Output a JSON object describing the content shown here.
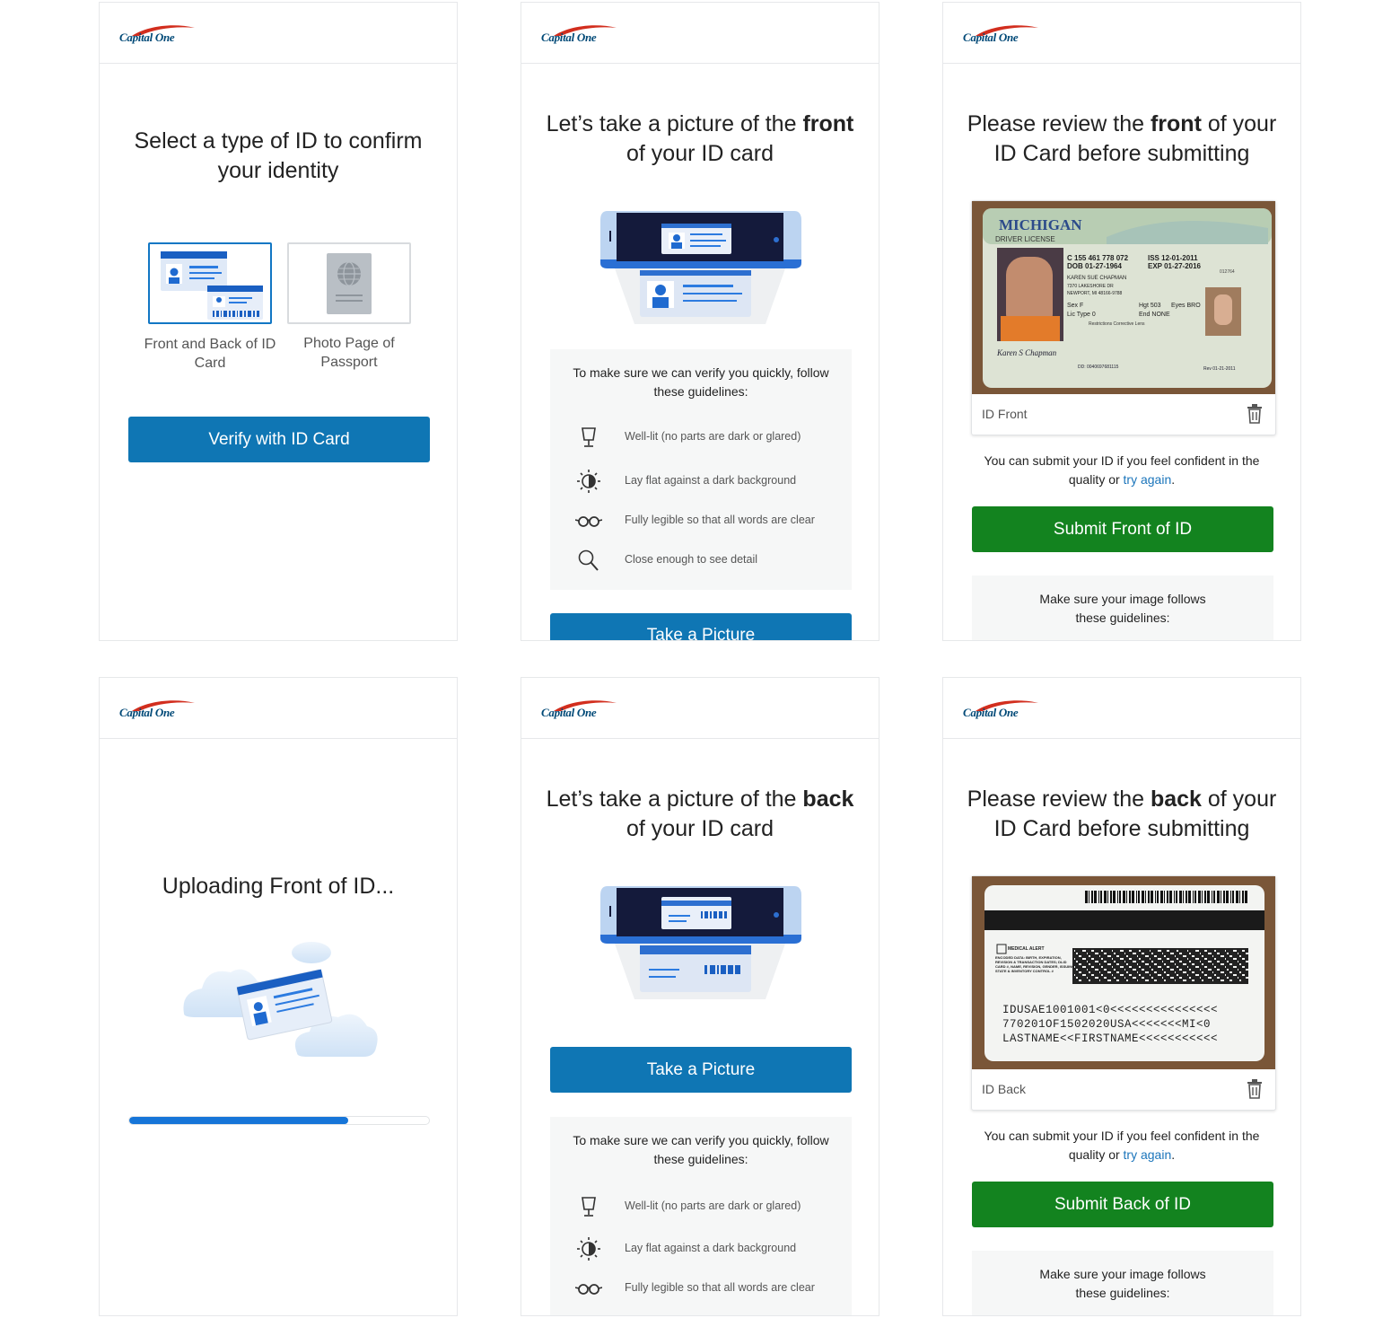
{
  "brand": {
    "name": "Capital One",
    "colors": {
      "primary_button": "#0f76b4",
      "submit_button": "#13831f",
      "link": "#1b75bb",
      "progress": "#1675d8"
    }
  },
  "screen1": {
    "title": "Select a type of ID to confirm your identity",
    "options": [
      {
        "label": "Front and Back of ID Card",
        "selected": true,
        "icon": "id-card-icon"
      },
      {
        "label": "Photo Page of Passport",
        "selected": false,
        "icon": "passport-icon"
      }
    ],
    "button": "Verify with ID Card"
  },
  "screen2": {
    "title_pre": "Let’s take a picture of the",
    "title_bold": "front",
    "title_post": "of your ID card",
    "guidelines_intro": "To make sure we can verify you quickly, follow these guidelines:",
    "guidelines": [
      {
        "text": "Well-lit (no parts are dark or glared)",
        "icon": "lamp-icon"
      },
      {
        "text": "Lay flat against a dark background",
        "icon": "contrast-icon"
      },
      {
        "text": "Fully legible so that all words are clear",
        "icon": "glasses-icon"
      },
      {
        "text": "Close enough to see detail",
        "icon": "magnifier-icon"
      }
    ],
    "button": "Take a Picture"
  },
  "screen3": {
    "title_pre": "Please review the",
    "title_bold": "front",
    "title_post": "of your ID Card before submitting",
    "photo_caption": "ID Front",
    "license": {
      "state": "MICHIGAN",
      "type": "DRIVER LICENSE",
      "number": "C 155 461 778 072",
      "dob": "DOB 01-27-1964",
      "iss": "ISS 12-01-2011",
      "exp": "EXP 01-27-2016",
      "name": "KAREN SUE CHAPMAN",
      "address1": "7370 LAKESHORE DR",
      "address2": "NEWPORT, MI 48166-9788",
      "sex": "Sex F",
      "hgt": "Hgt 503",
      "eyes": "Eyes BRO",
      "lic_type": "Lic Type 0",
      "end": "End NONE",
      "restrictions": "Restrictions Corrective Lens",
      "dd": "DD: 0040697681115",
      "rev": "Rev 01-21-2011",
      "signature": "Karen S Chapman",
      "side_id": "012764"
    },
    "confidence_pre": "You can submit your ID if you feel confident in the quality or",
    "confidence_link": "try again",
    "confidence_post": ".",
    "button": "Submit Front of ID",
    "guidelines_intro": "Make sure your image follows these guidelines:"
  },
  "screen4": {
    "title": "Uploading Front of ID...",
    "progress": 0.73
  },
  "screen5": {
    "title_pre": "Let’s take a picture of the",
    "title_bold": "back",
    "title_post": "of your ID card",
    "button": "Take a Picture",
    "guidelines_intro": "To make sure we can verify you quickly, follow these guidelines:",
    "guidelines": [
      {
        "text": "Well-lit (no parts are dark or glared)",
        "icon": "lamp-icon"
      },
      {
        "text": "Lay flat against a dark background",
        "icon": "contrast-icon"
      },
      {
        "text": "Fully legible so that all words are clear",
        "icon": "glasses-icon"
      }
    ]
  },
  "screen6": {
    "title_pre": "Please review the",
    "title_bold": "back",
    "title_post": "of your ID Card before submitting",
    "photo_caption": "ID Back",
    "back": {
      "medical": "MEDICAL ALERT",
      "encoded": "ENCODED DATA: BIRTH, EXPIRATION, REVISION & TRANSACTION DATES; DLID CARD #, NAME, REVISION, GENDER, ISSUING STATE & INVENTORY CONTROL #",
      "mrz1": "IDUSAE1001001<0<<<<<<<<<<<<<<<",
      "mrz2": "770201OF1502020USA<<<<<<<MI<0",
      "mrz3": "LASTNAME<<FIRSTNAME<<<<<<<<<<<"
    },
    "confidence_pre": "You can submit your ID if you feel confident in the quality or",
    "confidence_link": "try again",
    "confidence_post": ".",
    "button": "Submit Back of ID",
    "guidelines_intro": "Make sure your image follows these guidelines:"
  }
}
